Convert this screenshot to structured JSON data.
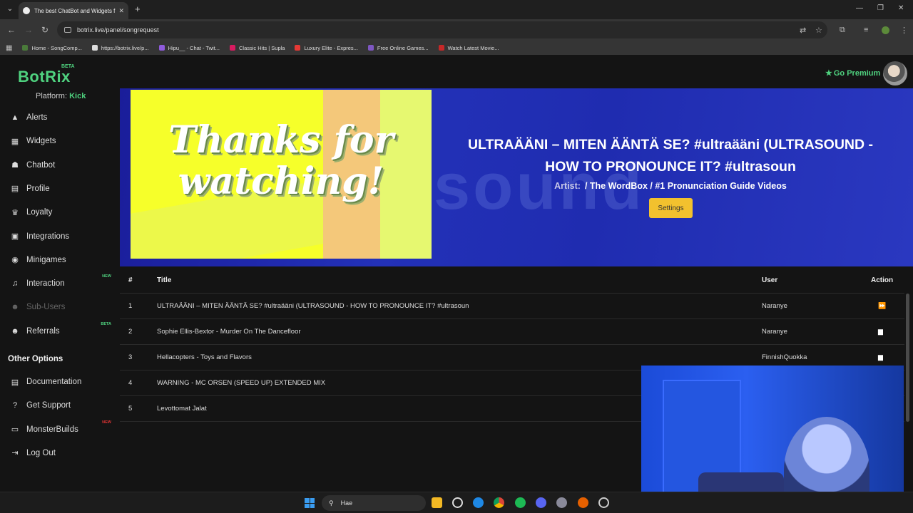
{
  "browser": {
    "tab_title": "The best ChatBot and Widgets f",
    "url": "botrix.live/panel/songrequest",
    "bookmarks": [
      {
        "label": "Home - SongComp...",
        "color": "#4a7a3a"
      },
      {
        "label": "https://botrix.live/p...",
        "color": "#ddd"
      },
      {
        "label": "Hipu__ - Chat - Twit...",
        "color": "#8f5bdc"
      },
      {
        "label": "Classic Hits | Supla",
        "color": "#d81b60"
      },
      {
        "label": "Luxury Elite - Expres...",
        "color": "#e53935"
      },
      {
        "label": "Free Online Games...",
        "color": "#7e57c2"
      },
      {
        "label": "Watch Latest Movie...",
        "color": "#c62828"
      }
    ]
  },
  "app": {
    "logo": "BotRix",
    "logo_badge": "BETA",
    "premium": "Go Premium",
    "platform_label": "Platform:",
    "platform_value": "Kick"
  },
  "sidebar": {
    "items": [
      {
        "label": "Alerts",
        "icon": "warning-icon"
      },
      {
        "label": "Widgets",
        "icon": "grid-icon"
      },
      {
        "label": "Chatbot",
        "icon": "robot-icon"
      },
      {
        "label": "Profile",
        "icon": "id-card-icon"
      },
      {
        "label": "Loyalty",
        "icon": "trophy-icon"
      },
      {
        "label": "Integrations",
        "icon": "integrations-icon"
      },
      {
        "label": "Minigames",
        "icon": "gamepad-icon"
      },
      {
        "label": "Interaction",
        "icon": "music-icon",
        "badge": "NEW"
      },
      {
        "label": "Sub-Users",
        "icon": "users-icon",
        "disabled": true
      },
      {
        "label": "Referrals",
        "icon": "referrals-icon",
        "badge": "BETA"
      }
    ],
    "other_title": "Other Options",
    "other_items": [
      {
        "label": "Documentation",
        "icon": "book-icon"
      },
      {
        "label": "Get Support",
        "icon": "question-icon"
      },
      {
        "label": "MonsterBuilds",
        "icon": "laptop-icon",
        "badge": "NEW"
      },
      {
        "label": "Log Out",
        "icon": "logout-icon"
      }
    ]
  },
  "now_playing": {
    "thumbnail_text": "Thanks for watching!",
    "title": "ULTRAÄÄNI – MITEN ÄÄNTÄ SE? #ultraääni (ULTRASOUND - HOW TO PRONOUNCE IT? #ultrasoun",
    "artist_label": "Artist:",
    "artist": "/ The WordBox / #1 Pronunciation Guide Videos",
    "settings_label": "Settings",
    "bg_ghost_text": "sound"
  },
  "queue": {
    "headers": {
      "num": "#",
      "title": "Title",
      "user": "User",
      "action": "Action"
    },
    "rows": [
      {
        "num": "1",
        "title": "ULTRAÄÄNI – MITEN ÄÄNTÄ SE? #ultraääni (ULTRASOUND - HOW TO PRONOUNCE IT? #ultrasoun",
        "user": "Naranye",
        "action": "skip"
      },
      {
        "num": "2",
        "title": "Sophie Ellis-Bextor - Murder On The Dancefloor",
        "user": "Naranye",
        "action": "delete"
      },
      {
        "num": "3",
        "title": "Hellacopters - Toys and Flavors",
        "user": "FinnishQuokka",
        "action": "delete"
      },
      {
        "num": "4",
        "title": "WARNING - MC ORSEN (SPEED UP) EXTENDED MIX",
        "user": "",
        "action": ""
      },
      {
        "num": "5",
        "title": "Levottomat Jalat",
        "user": "",
        "action": ""
      }
    ]
  },
  "taskbar": {
    "search_placeholder": "Hae"
  }
}
